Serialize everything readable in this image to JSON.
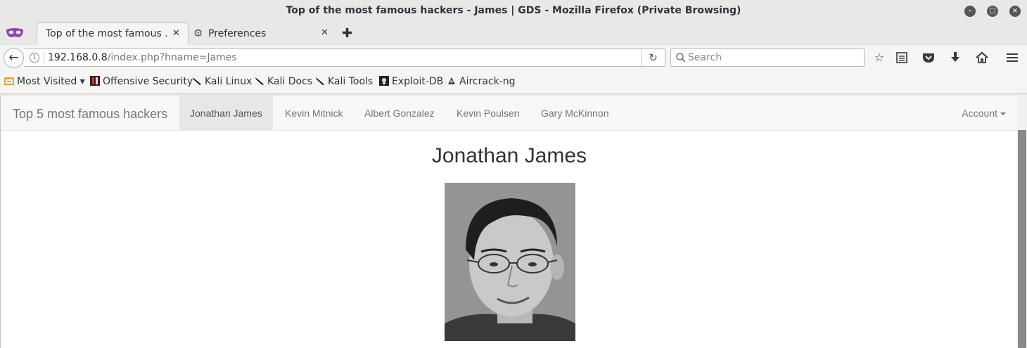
{
  "window": {
    "title": "Top of the most famous hackers - James | GDS - Mozilla Firefox (Private Browsing)",
    "minimize_glyph": "–",
    "maximize_glyph": "□",
    "close_glyph": "×"
  },
  "tabs": [
    {
      "label": "Top of the most famous ...",
      "close": "✕",
      "active": true
    },
    {
      "label": "Preferences",
      "close": "✕",
      "active": false,
      "icon": "gear-icon"
    }
  ],
  "new_tab_glyph": "✚",
  "navbar": {
    "back_glyph": "←",
    "url_host": "192.168.0.8",
    "url_path": "/index.php?hname=James",
    "reload_glyph": "↻",
    "search_placeholder": "Search",
    "toolbar_icons": [
      "bookmark-star-icon",
      "reader-list-icon",
      "pocket-icon",
      "downloads-icon",
      "home-icon",
      "menu-icon"
    ]
  },
  "bookmarks": [
    {
      "label": "Most Visited ▾",
      "icon": "most-visited-icon"
    },
    {
      "label": "Offensive Security",
      "icon": "offsec-icon"
    },
    {
      "label": "Kali Linux",
      "icon": "kali-dragon-icon"
    },
    {
      "label": "Kali Docs",
      "icon": "kali-dragon-icon"
    },
    {
      "label": "Kali Tools",
      "icon": "kali-dragon-icon"
    },
    {
      "label": "Exploit-DB",
      "icon": "exploit-db-icon"
    },
    {
      "label": "Aircrack-ng",
      "icon": "aircrack-icon"
    }
  ],
  "site": {
    "brand": "Top 5 most famous hackers",
    "nav": [
      {
        "label": "Jonathan James",
        "active": true
      },
      {
        "label": "Kevin Mitnick",
        "active": false
      },
      {
        "label": "Albert Gonzalez",
        "active": false
      },
      {
        "label": "Kevin Poulsen",
        "active": false
      },
      {
        "label": "Gary McKinnon",
        "active": false
      }
    ],
    "account": "Account",
    "heading": "Jonathan James"
  }
}
